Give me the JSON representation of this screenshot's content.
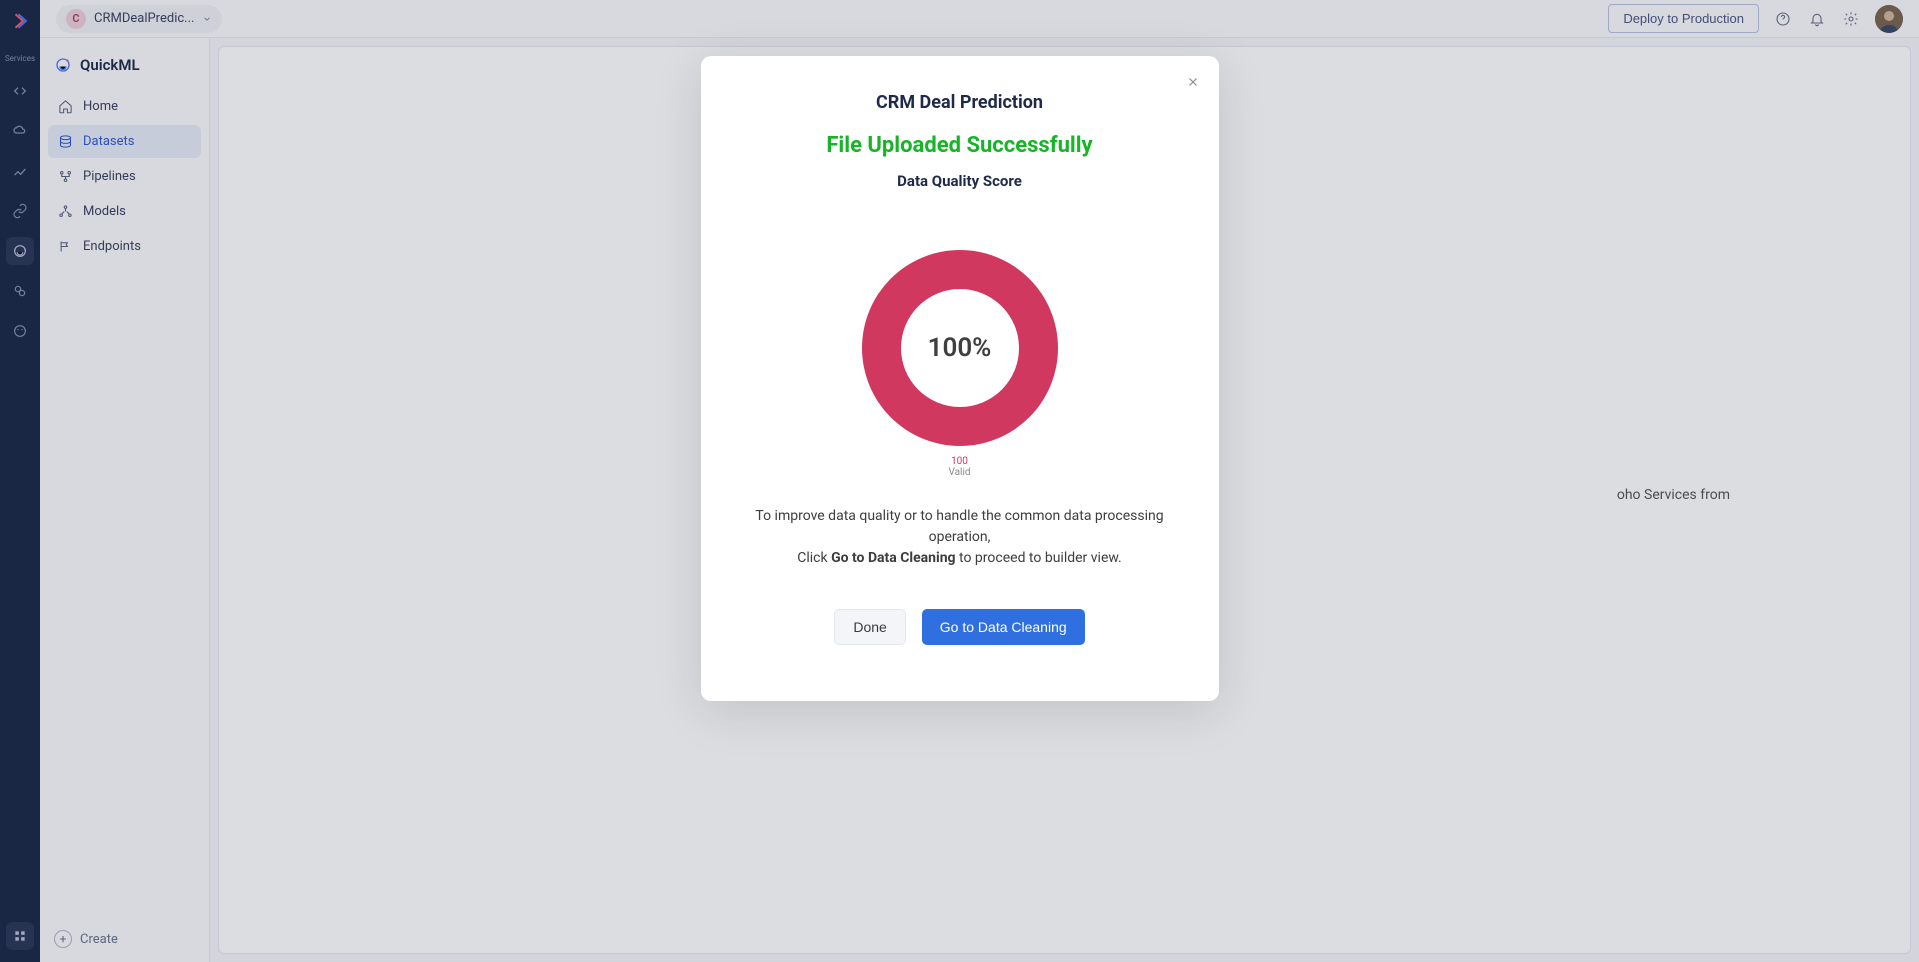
{
  "iconSidebar": {
    "servicesLabel": "Services"
  },
  "topBar": {
    "project": {
      "initial": "C",
      "name": "CRMDealPredic..."
    },
    "deployLabel": "Deploy to Production"
  },
  "appSidebar": {
    "title": "QuickML",
    "nav": [
      {
        "label": "Home"
      },
      {
        "label": "Datasets"
      },
      {
        "label": "Pipelines"
      },
      {
        "label": "Models"
      },
      {
        "label": "Endpoints"
      }
    ],
    "createLabel": "Create"
  },
  "mainHint": "oho Services from",
  "modal": {
    "title": "CRM Deal Prediction",
    "successMsg": "File Uploaded Successfully",
    "subtitle": "Data Quality Score",
    "score": "100%",
    "legendValue": "100",
    "legendLabel": "Valid",
    "descLine1": "To improve data quality or to handle the common data processing operation,",
    "descPrefix": "Click ",
    "descBold": "Go to Data Cleaning",
    "descSuffix": " to proceed to builder view.",
    "doneLabel": "Done",
    "cleanLabel": "Go to Data Cleaning"
  },
  "chart_data": {
    "type": "pie",
    "title": "Data Quality Score",
    "series": [
      {
        "name": "Valid",
        "value": 100
      }
    ],
    "center_label": "100%"
  }
}
